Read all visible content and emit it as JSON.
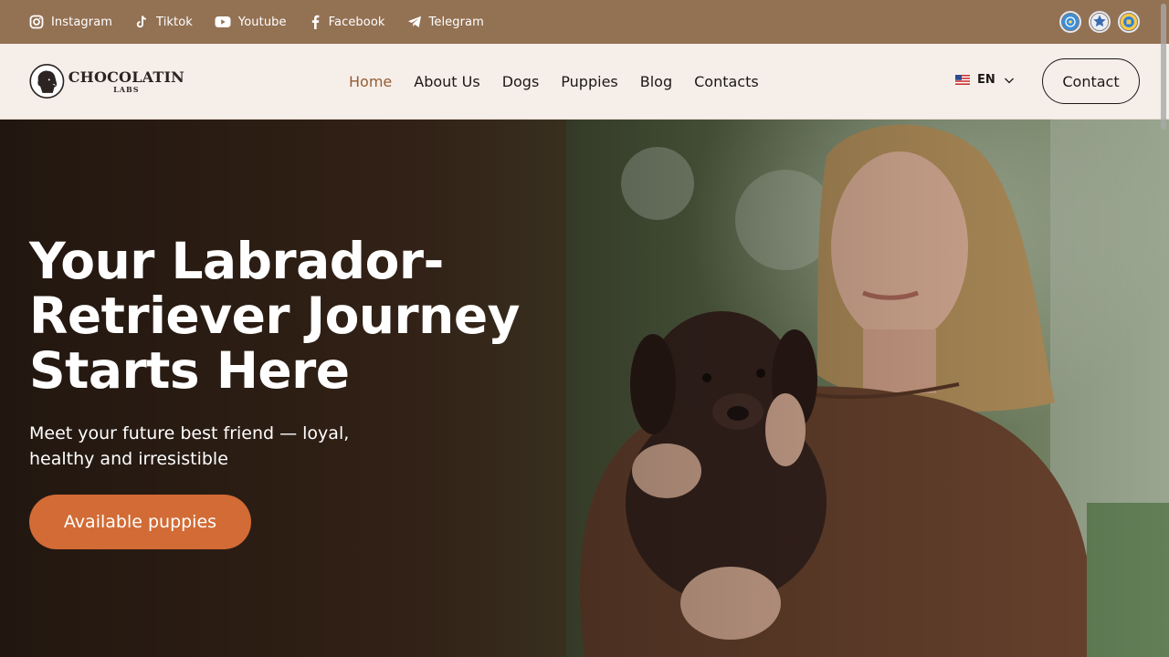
{
  "topbar": {
    "social": [
      {
        "icon": "instagram-icon",
        "label": "Instagram"
      },
      {
        "icon": "tiktok-icon",
        "label": "Tiktok"
      },
      {
        "icon": "youtube-icon",
        "label": "Youtube"
      },
      {
        "icon": "facebook-icon",
        "label": "Facebook"
      },
      {
        "icon": "telegram-icon",
        "label": "Telegram"
      }
    ],
    "badges": [
      "fci-badge",
      "club-badge",
      "kennel-badge"
    ]
  },
  "header": {
    "logo": {
      "main": "CHOCOLATIN",
      "sub": "LABS"
    },
    "nav": [
      {
        "label": "Home",
        "active": true
      },
      {
        "label": "About Us"
      },
      {
        "label": "Dogs"
      },
      {
        "label": "Puppies"
      },
      {
        "label": "Blog"
      },
      {
        "label": "Contacts"
      }
    ],
    "language": {
      "flag": "us-flag-icon",
      "code": "EN"
    },
    "contact_button": "Contact"
  },
  "hero": {
    "title_lines": [
      "Your Labrador-",
      "Retriever Journey",
      "Starts Here"
    ],
    "subtitle": "Meet your future best friend — loyal, healthy and irresistible",
    "cta": "Available puppies"
  },
  "colors": {
    "topbar_bg": "#937153",
    "header_bg": "#f6efe9",
    "active_nav": "#955c33",
    "cta_bg": "#d26b35"
  }
}
